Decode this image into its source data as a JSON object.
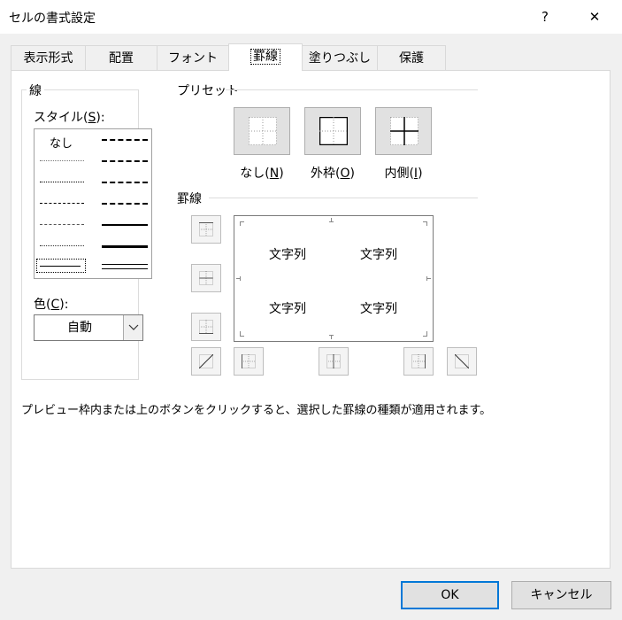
{
  "window": {
    "title": "セルの書式設定",
    "help_glyph": "?",
    "close_glyph": "✕"
  },
  "tabs": [
    {
      "label": "表示形式"
    },
    {
      "label": "配置"
    },
    {
      "label": "フォント"
    },
    {
      "label": "罫線",
      "active": true
    },
    {
      "label": "塗りつぶし"
    },
    {
      "label": "保護"
    }
  ],
  "line_group": {
    "title": "線",
    "style_label": "スタイル(",
    "style_key": "S",
    "style_suffix": "):",
    "none_label": "なし",
    "color_label": "色(",
    "color_key": "C",
    "color_suffix": "):",
    "color_value": "自動"
  },
  "presets": {
    "title": "プリセット",
    "items": [
      {
        "label": "なし(",
        "key": "N",
        "suffix": ")"
      },
      {
        "label": "外枠(",
        "key": "O",
        "suffix": ")"
      },
      {
        "label": "内側(",
        "key": "I",
        "suffix": ")"
      }
    ]
  },
  "border": {
    "title": "罫線",
    "preview_text": [
      "文字列",
      "文字列",
      "文字列",
      "文字列"
    ]
  },
  "description": "プレビュー枠内または上のボタンをクリックすると、選択した罫線の種類が適用されます。",
  "buttons": {
    "ok": "OK",
    "cancel": "キャンセル"
  },
  "icons": [
    "help-icon",
    "close-icon",
    "chevron-down-icon"
  ]
}
